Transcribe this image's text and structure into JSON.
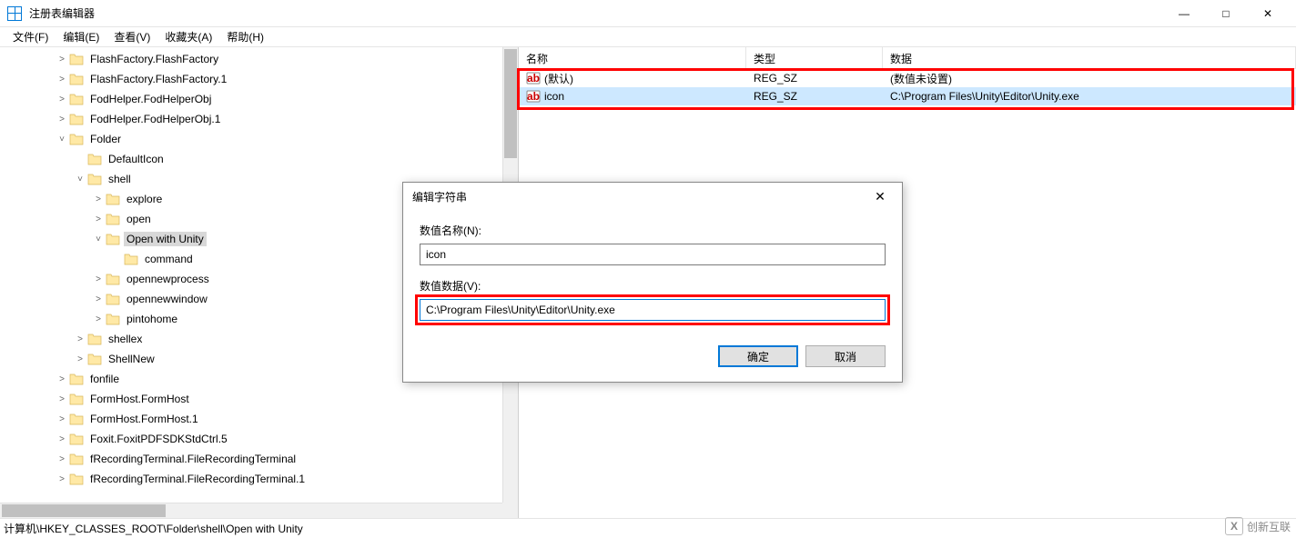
{
  "window": {
    "title": "注册表编辑器"
  },
  "menu": {
    "file": "文件(F)",
    "edit": "编辑(E)",
    "view": "查看(V)",
    "favorites": "收藏夹(A)",
    "help": "帮助(H)"
  },
  "tree": [
    {
      "indent": 2,
      "expander": ">",
      "label": "FlashFactory.FlashFactory"
    },
    {
      "indent": 2,
      "expander": ">",
      "label": "FlashFactory.FlashFactory.1"
    },
    {
      "indent": 2,
      "expander": ">",
      "label": "FodHelper.FodHelperObj"
    },
    {
      "indent": 2,
      "expander": ">",
      "label": "FodHelper.FodHelperObj.1"
    },
    {
      "indent": 2,
      "expander": "v",
      "label": "Folder"
    },
    {
      "indent": 3,
      "expander": "",
      "label": "DefaultIcon"
    },
    {
      "indent": 3,
      "expander": "v",
      "label": "shell"
    },
    {
      "indent": 4,
      "expander": ">",
      "label": "explore"
    },
    {
      "indent": 4,
      "expander": ">",
      "label": "open"
    },
    {
      "indent": 4,
      "expander": "v",
      "label": "Open with Unity",
      "selected": true
    },
    {
      "indent": 5,
      "expander": "",
      "label": "command"
    },
    {
      "indent": 4,
      "expander": ">",
      "label": "opennewprocess"
    },
    {
      "indent": 4,
      "expander": ">",
      "label": "opennewwindow"
    },
    {
      "indent": 4,
      "expander": ">",
      "label": "pintohome"
    },
    {
      "indent": 3,
      "expander": ">",
      "label": "shellex"
    },
    {
      "indent": 3,
      "expander": ">",
      "label": "ShellNew"
    },
    {
      "indent": 2,
      "expander": ">",
      "label": "fonfile"
    },
    {
      "indent": 2,
      "expander": ">",
      "label": "FormHost.FormHost"
    },
    {
      "indent": 2,
      "expander": ">",
      "label": "FormHost.FormHost.1"
    },
    {
      "indent": 2,
      "expander": ">",
      "label": "Foxit.FoxitPDFSDKStdCtrl.5"
    },
    {
      "indent": 2,
      "expander": ">",
      "label": "fRecordingTerminal.FileRecordingTerminal"
    },
    {
      "indent": 2,
      "expander": ">",
      "label": "fRecordingTerminal.FileRecordingTerminal.1"
    }
  ],
  "list": {
    "headers": {
      "name": "名称",
      "type": "类型",
      "data": "数据"
    },
    "rows": [
      {
        "name": "(默认)",
        "type": "REG_SZ",
        "data": "(数值未设置)",
        "selected": false
      },
      {
        "name": "icon",
        "type": "REG_SZ",
        "data": "C:\\Program Files\\Unity\\Editor\\Unity.exe",
        "selected": true
      }
    ]
  },
  "dialog": {
    "title": "编辑字符串",
    "name_label": "数值名称(N):",
    "name_value": "icon",
    "data_label": "数值数据(V):",
    "data_value": "C:\\Program Files\\Unity\\Editor\\Unity.exe",
    "ok": "确定",
    "cancel": "取消"
  },
  "status": {
    "path": "计算机\\HKEY_CLASSES_ROOT\\Folder\\shell\\Open with Unity"
  },
  "watermark": "创新互联"
}
